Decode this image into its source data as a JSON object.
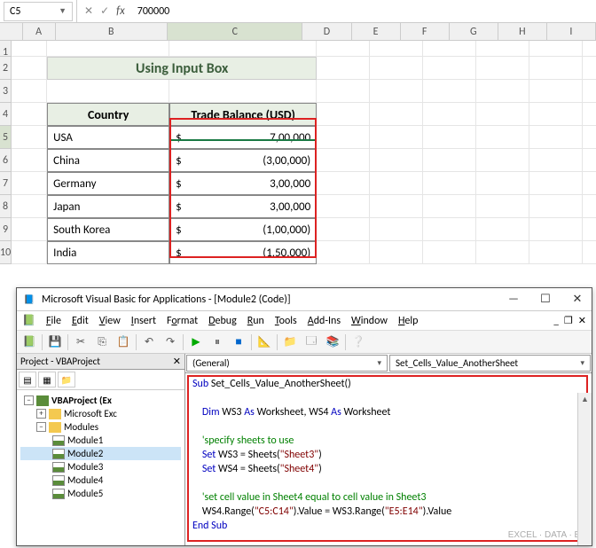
{
  "formula_bar": {
    "name_box": "C5",
    "formula": "700000"
  },
  "columns": [
    "A",
    "B",
    "C",
    "D",
    "E",
    "F",
    "G",
    "H",
    "I"
  ],
  "row_nums": [
    1,
    2,
    3,
    4,
    5,
    6,
    7,
    8,
    9,
    10
  ],
  "sheet": {
    "title": "Using Input Box",
    "headers": {
      "b": "Country",
      "c": "Trade Balance (USD)"
    },
    "rows": [
      {
        "country": "USA",
        "sym": "$",
        "val": "7,00,000"
      },
      {
        "country": "China",
        "sym": "$",
        "val": "(3,00,000)"
      },
      {
        "country": "Germany",
        "sym": "$",
        "val": "3,00,000"
      },
      {
        "country": "Japan",
        "sym": "$",
        "val": "3,00,000"
      },
      {
        "country": "South Korea",
        "sym": "$",
        "val": "(1,00,000)"
      },
      {
        "country": "India",
        "sym": "$",
        "val": "(1,50,000)"
      }
    ]
  },
  "vba": {
    "title": "Microsoft Visual Basic for Applications - [Module2 (Code)]",
    "menu": [
      "File",
      "Edit",
      "View",
      "Insert",
      "Format",
      "Debug",
      "Run",
      "Tools",
      "Add-Ins",
      "Window",
      "Help"
    ],
    "project_header": "Project - VBAProject",
    "tree": {
      "root": "VBAProject (Ex",
      "items": [
        "Microsoft Exc",
        "Modules"
      ],
      "modules": [
        "Module1",
        "Module2",
        "Module3",
        "Module4",
        "Module5"
      ]
    },
    "dd_left": "(General)",
    "dd_right": "Set_Cells_Value_AnotherSheet",
    "code": {
      "l1a": "Sub",
      "l1b": " Set_Cells_Value_AnotherSheet()",
      "l2a": "    Dim",
      "l2b": " WS3 ",
      "l2c": "As",
      "l2d": " Worksheet, WS4 ",
      "l2e": "As",
      "l2f": " Worksheet",
      "l3": "    'specify sheets to use",
      "l4a": "    Set",
      "l4b": " WS3 = Sheets(",
      "l4c": "\"Sheet3\"",
      "l4d": ")",
      "l5a": "    Set",
      "l5b": " WS4 = Sheets(",
      "l5c": "\"Sheet4\"",
      "l5d": ")",
      "l6": "    'set cell value in Sheet4 equal to cell value in Sheet3",
      "l7a": "    WS4.Range(",
      "l7b": "\"C5:C14\"",
      "l7c": ").Value = WS3.Range(",
      "l7d": "\"E5:E14\"",
      "l7e": ").Value",
      "l8": "End Sub"
    },
    "watermark": "EXCEL · DATA · BI"
  }
}
